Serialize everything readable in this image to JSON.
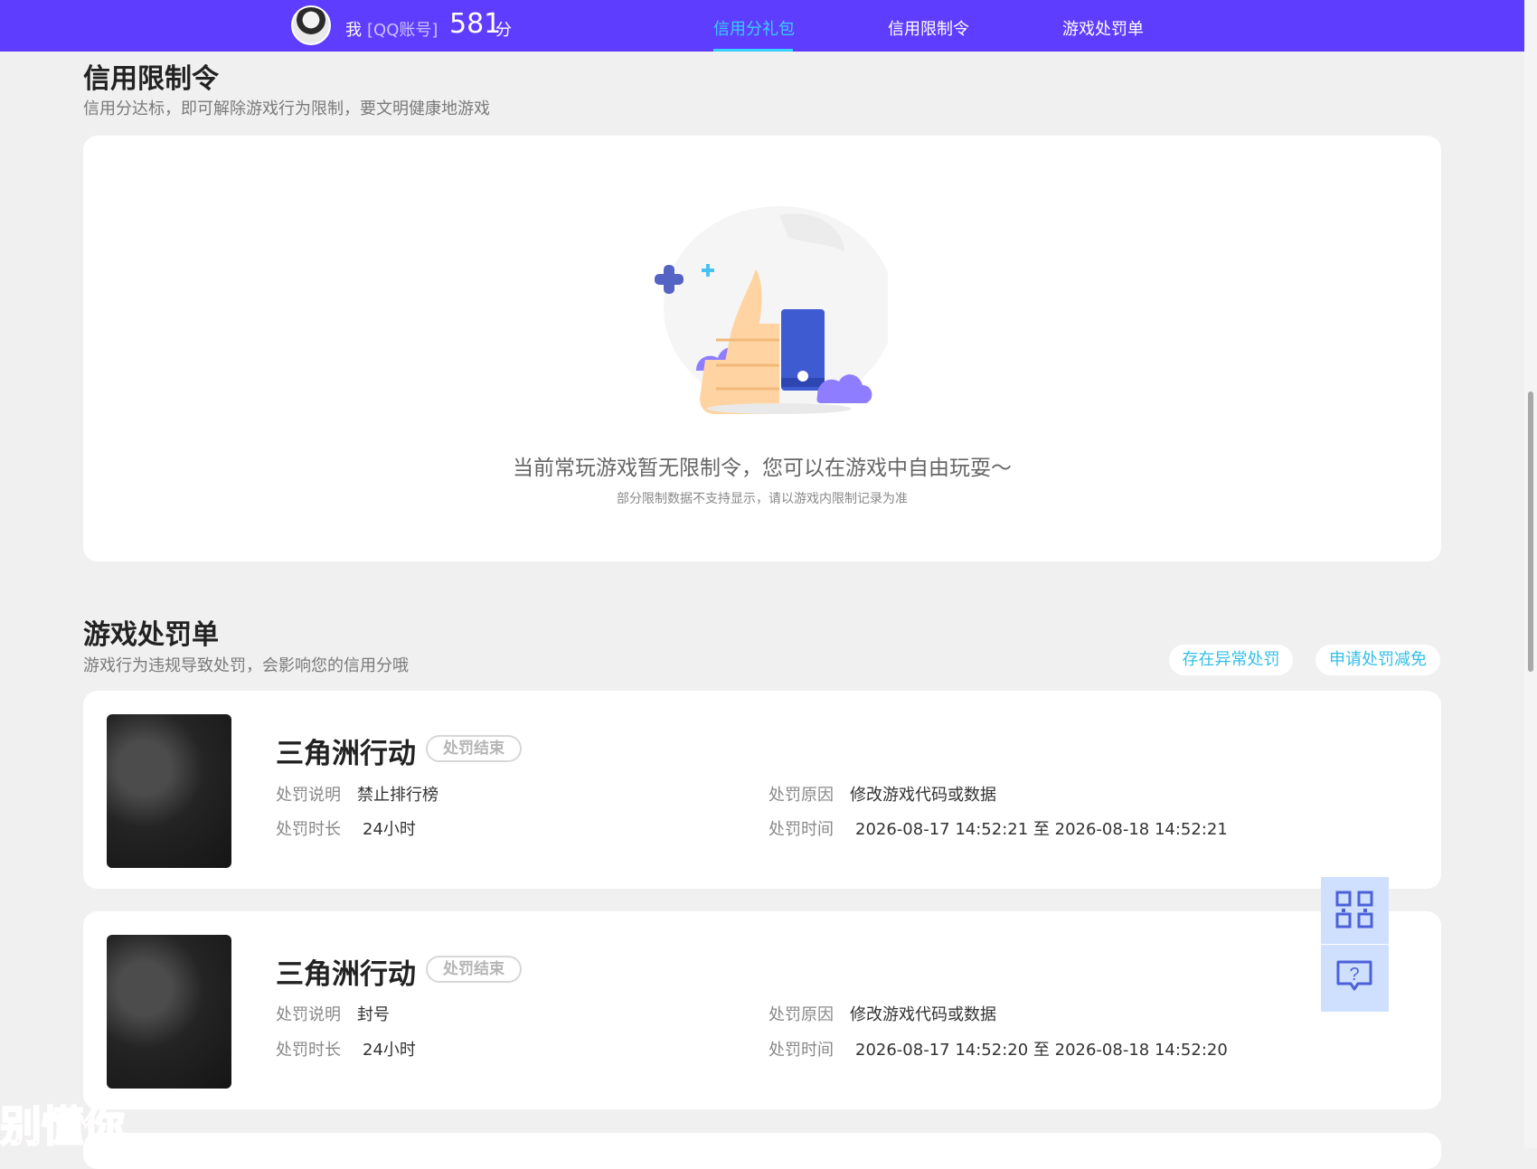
{
  "header": {
    "me": "我",
    "account": "[QQ账号]",
    "score": "581",
    "score_unit": "分",
    "tabs": [
      "信用分礼包",
      "信用限制令",
      "游戏处罚单"
    ]
  },
  "restrictions": {
    "title": "信用限制令",
    "subtitle": "信用分达标，即可解除游戏行为限制，要文明健康地游戏",
    "empty_text": "当前常玩游戏暂无限制令，您可以在游戏中自由玩耍～",
    "empty_note": "部分限制数据不支持显示，请以游戏内限制记录为准"
  },
  "penalties": {
    "title": "游戏处罚单",
    "subtitle": "游戏行为违规导致处罚，会影响您的信用分哦",
    "buttons": [
      "存在异常处罚",
      "申请处罚减免"
    ],
    "labels": {
      "desc": "处罚说明",
      "duration": "处罚时长",
      "reason": "处罚原因",
      "time": "处罚时间"
    },
    "items": [
      {
        "game": "三角洲行动",
        "status": "处罚结束",
        "desc": "禁止排行榜",
        "duration": "24小时",
        "reason": "修改游戏代码或数据",
        "time": "2026-08-17 14:52:21 至 2026-08-18 14:52:21"
      },
      {
        "game": "三角洲行动",
        "status": "处罚结束",
        "desc": "封号",
        "duration": "24小时",
        "reason": "修改游戏代码或数据",
        "time": "2026-08-17 14:52:20 至 2026-08-18 14:52:20"
      }
    ]
  },
  "side_icons": [
    "qr-code-icon",
    "help-chat-icon"
  ],
  "watermark": "别懂你"
}
